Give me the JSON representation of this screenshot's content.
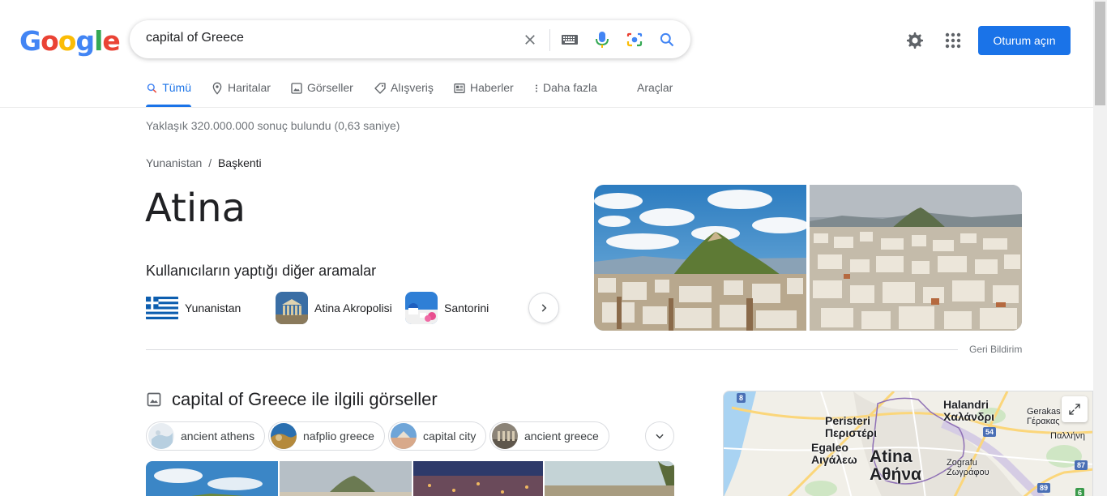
{
  "logo": {
    "text": "Google"
  },
  "search": {
    "query": "capital of Greece"
  },
  "header": {
    "signin_label": "Oturum açın"
  },
  "tabs": [
    {
      "label": "Tümü",
      "icon": "search-icon"
    },
    {
      "label": "Haritalar",
      "icon": "map-pin-icon"
    },
    {
      "label": "Görseller",
      "icon": "image-icon"
    },
    {
      "label": "Alışveriş",
      "icon": "tag-icon"
    },
    {
      "label": "Haberler",
      "icon": "news-icon"
    },
    {
      "label": "Daha fazla",
      "icon": "more-vert-icon"
    },
    {
      "label": "Araçlar"
    }
  ],
  "results": {
    "stats": "Yaklaşık 320.000.000 sonuç bulundu (0,63 saniye)",
    "breadcrumb": {
      "parent": "Yunanistan",
      "separator": "/",
      "current": "Başkenti"
    },
    "answer": "Atina",
    "also_searched_title": "Kullanıcıların yaptığı diğer aramalar",
    "also_searched": [
      {
        "label": "Yunanistan"
      },
      {
        "label": "Atina Akropolisi"
      },
      {
        "label": "Santorini"
      }
    ],
    "feedback": "Geri Bildirim"
  },
  "images_section": {
    "title": "capital of Greece ile ilgili görseller",
    "chips": [
      "ancient athens",
      "nafplio greece",
      "capital city",
      "ancient greece"
    ]
  },
  "map": {
    "labels": {
      "halandri_latin": "Halandri",
      "halandri_greek": "Χαλάνδρι",
      "peristeri_latin": "Peristeri",
      "peristeri_greek": "Περιστέρι",
      "egaleo_latin": "Egaleo",
      "egaleo_greek": "Αιγάλεω",
      "athina_latin": "Atina",
      "athina_greek": "Αθήνα",
      "zografou_latin": "Zografu",
      "zografou_greek": "Ζωγράφου",
      "gerakas_latin": "Gerakas",
      "gerakas_greek": "Γέρακας",
      "pallini_greek": "Παλλήνη"
    },
    "road_numbers": [
      "8",
      "54",
      "87",
      "89",
      "6"
    ]
  },
  "colors": {
    "accent": "#1a73e8",
    "text": "#202124",
    "muted": "#70757a"
  }
}
